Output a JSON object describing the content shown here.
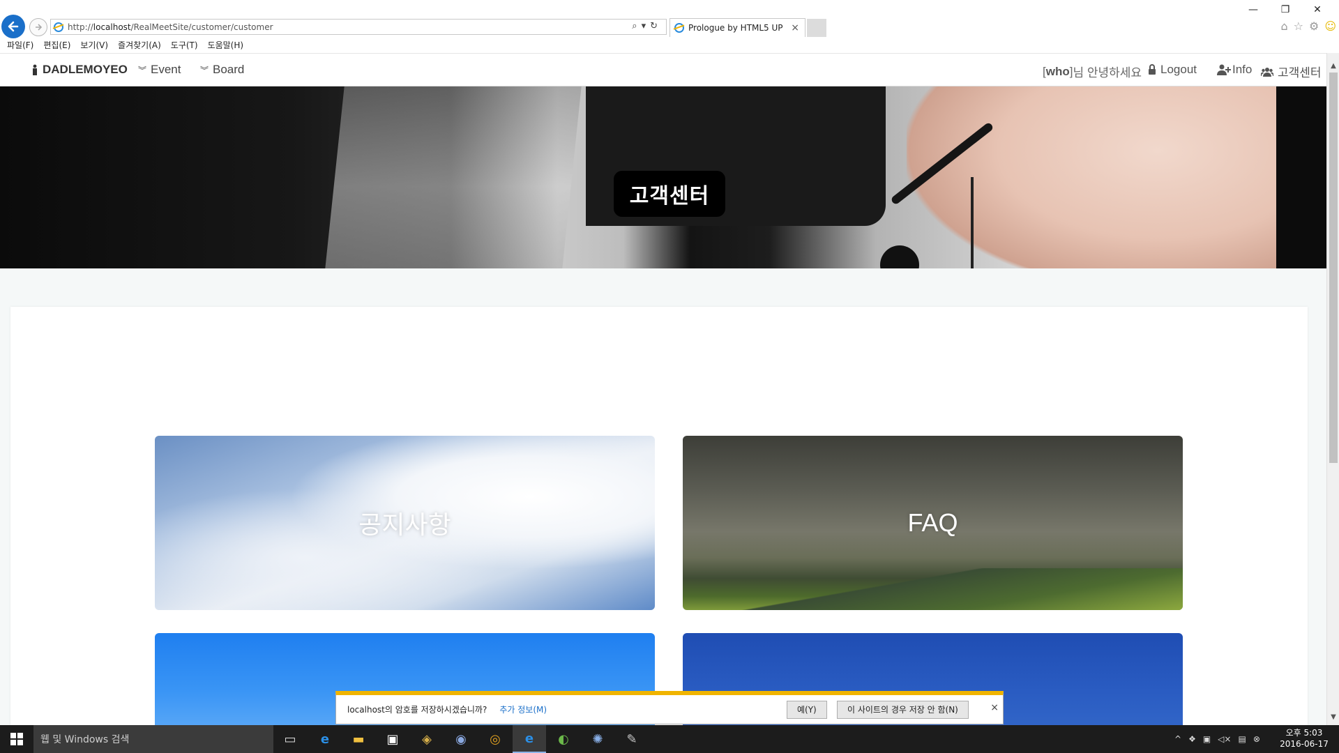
{
  "browser": {
    "url_prefix": "http://",
    "url_host": "localhost",
    "url_path": "/RealMeetSite/customer/customer",
    "tab_title": "Prologue by HTML5 UP",
    "tab_close": "×",
    "addr_tools": "⌕▾↻",
    "window_controls": {
      "minimize": "—",
      "restore": "❐",
      "close": "✕"
    },
    "menu": [
      "파일(F)",
      "편집(E)",
      "보기(V)",
      "즐겨찾기(A)",
      "도구(T)",
      "도움말(H)"
    ]
  },
  "site_nav": {
    "brand": "DADLEMOYEO",
    "event": "Event",
    "board": "Board",
    "greeting_user": "who",
    "greeting_text": "님 안녕하세요",
    "logout": "Logout",
    "info": "Info",
    "customer_center": "고객센터"
  },
  "hero": {
    "title": "고객센터"
  },
  "cards": [
    {
      "label": "공지사항"
    },
    {
      "label": "FAQ"
    },
    {
      "label": ""
    },
    {
      "label": ""
    }
  ],
  "password_bar": {
    "message": "localhost의 암호를 저장하시겠습니까?",
    "more_info": "추가 정보(M)",
    "yes": "예(Y)",
    "never": "이 사이트의 경우 저장 안 함(N)",
    "close": "×"
  },
  "taskbar": {
    "search_placeholder": "웹 및 Windows 검색",
    "time": "오후 5:03",
    "date": "2016-06-17"
  },
  "colors": {
    "ie_blue": "#1a6fc9",
    "notification_accent": "#f0b400",
    "taskbar": "#1c1c1c"
  },
  "icons": [
    "back-arrow-icon",
    "forward-arrow-icon",
    "ie-icon",
    "search-icon",
    "refresh-icon",
    "home-icon",
    "star-icon",
    "gear-icon",
    "smiley-icon",
    "user-icon",
    "lock-icon",
    "user-plus-icon",
    "users-icon",
    "chevron-double-down-icon",
    "windows-logo-icon"
  ]
}
